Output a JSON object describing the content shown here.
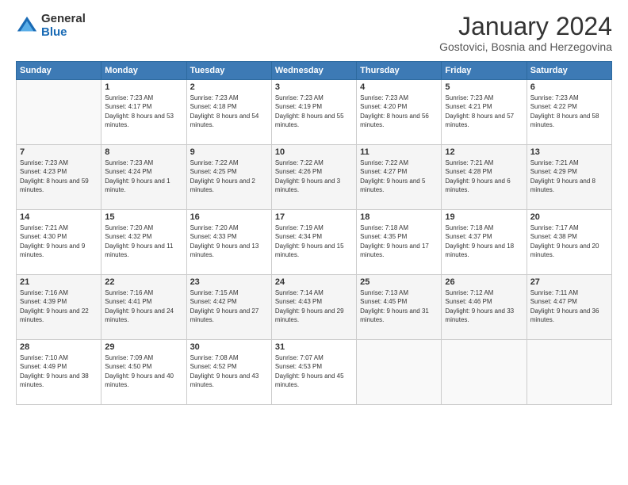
{
  "logo": {
    "general": "General",
    "blue": "Blue"
  },
  "title": "January 2024",
  "subtitle": "Gostovici, Bosnia and Herzegovina",
  "days_header": [
    "Sunday",
    "Monday",
    "Tuesday",
    "Wednesday",
    "Thursday",
    "Friday",
    "Saturday"
  ],
  "weeks": [
    [
      {
        "num": "",
        "sunrise": "",
        "sunset": "",
        "daylight": ""
      },
      {
        "num": "1",
        "sunrise": "Sunrise: 7:23 AM",
        "sunset": "Sunset: 4:17 PM",
        "daylight": "Daylight: 8 hours and 53 minutes."
      },
      {
        "num": "2",
        "sunrise": "Sunrise: 7:23 AM",
        "sunset": "Sunset: 4:18 PM",
        "daylight": "Daylight: 8 hours and 54 minutes."
      },
      {
        "num": "3",
        "sunrise": "Sunrise: 7:23 AM",
        "sunset": "Sunset: 4:19 PM",
        "daylight": "Daylight: 8 hours and 55 minutes."
      },
      {
        "num": "4",
        "sunrise": "Sunrise: 7:23 AM",
        "sunset": "Sunset: 4:20 PM",
        "daylight": "Daylight: 8 hours and 56 minutes."
      },
      {
        "num": "5",
        "sunrise": "Sunrise: 7:23 AM",
        "sunset": "Sunset: 4:21 PM",
        "daylight": "Daylight: 8 hours and 57 minutes."
      },
      {
        "num": "6",
        "sunrise": "Sunrise: 7:23 AM",
        "sunset": "Sunset: 4:22 PM",
        "daylight": "Daylight: 8 hours and 58 minutes."
      }
    ],
    [
      {
        "num": "7",
        "sunrise": "Sunrise: 7:23 AM",
        "sunset": "Sunset: 4:23 PM",
        "daylight": "Daylight: 8 hours and 59 minutes."
      },
      {
        "num": "8",
        "sunrise": "Sunrise: 7:23 AM",
        "sunset": "Sunset: 4:24 PM",
        "daylight": "Daylight: 9 hours and 1 minute."
      },
      {
        "num": "9",
        "sunrise": "Sunrise: 7:22 AM",
        "sunset": "Sunset: 4:25 PM",
        "daylight": "Daylight: 9 hours and 2 minutes."
      },
      {
        "num": "10",
        "sunrise": "Sunrise: 7:22 AM",
        "sunset": "Sunset: 4:26 PM",
        "daylight": "Daylight: 9 hours and 3 minutes."
      },
      {
        "num": "11",
        "sunrise": "Sunrise: 7:22 AM",
        "sunset": "Sunset: 4:27 PM",
        "daylight": "Daylight: 9 hours and 5 minutes."
      },
      {
        "num": "12",
        "sunrise": "Sunrise: 7:21 AM",
        "sunset": "Sunset: 4:28 PM",
        "daylight": "Daylight: 9 hours and 6 minutes."
      },
      {
        "num": "13",
        "sunrise": "Sunrise: 7:21 AM",
        "sunset": "Sunset: 4:29 PM",
        "daylight": "Daylight: 9 hours and 8 minutes."
      }
    ],
    [
      {
        "num": "14",
        "sunrise": "Sunrise: 7:21 AM",
        "sunset": "Sunset: 4:30 PM",
        "daylight": "Daylight: 9 hours and 9 minutes."
      },
      {
        "num": "15",
        "sunrise": "Sunrise: 7:20 AM",
        "sunset": "Sunset: 4:32 PM",
        "daylight": "Daylight: 9 hours and 11 minutes."
      },
      {
        "num": "16",
        "sunrise": "Sunrise: 7:20 AM",
        "sunset": "Sunset: 4:33 PM",
        "daylight": "Daylight: 9 hours and 13 minutes."
      },
      {
        "num": "17",
        "sunrise": "Sunrise: 7:19 AM",
        "sunset": "Sunset: 4:34 PM",
        "daylight": "Daylight: 9 hours and 15 minutes."
      },
      {
        "num": "18",
        "sunrise": "Sunrise: 7:18 AM",
        "sunset": "Sunset: 4:35 PM",
        "daylight": "Daylight: 9 hours and 17 minutes."
      },
      {
        "num": "19",
        "sunrise": "Sunrise: 7:18 AM",
        "sunset": "Sunset: 4:37 PM",
        "daylight": "Daylight: 9 hours and 18 minutes."
      },
      {
        "num": "20",
        "sunrise": "Sunrise: 7:17 AM",
        "sunset": "Sunset: 4:38 PM",
        "daylight": "Daylight: 9 hours and 20 minutes."
      }
    ],
    [
      {
        "num": "21",
        "sunrise": "Sunrise: 7:16 AM",
        "sunset": "Sunset: 4:39 PM",
        "daylight": "Daylight: 9 hours and 22 minutes."
      },
      {
        "num": "22",
        "sunrise": "Sunrise: 7:16 AM",
        "sunset": "Sunset: 4:41 PM",
        "daylight": "Daylight: 9 hours and 24 minutes."
      },
      {
        "num": "23",
        "sunrise": "Sunrise: 7:15 AM",
        "sunset": "Sunset: 4:42 PM",
        "daylight": "Daylight: 9 hours and 27 minutes."
      },
      {
        "num": "24",
        "sunrise": "Sunrise: 7:14 AM",
        "sunset": "Sunset: 4:43 PM",
        "daylight": "Daylight: 9 hours and 29 minutes."
      },
      {
        "num": "25",
        "sunrise": "Sunrise: 7:13 AM",
        "sunset": "Sunset: 4:45 PM",
        "daylight": "Daylight: 9 hours and 31 minutes."
      },
      {
        "num": "26",
        "sunrise": "Sunrise: 7:12 AM",
        "sunset": "Sunset: 4:46 PM",
        "daylight": "Daylight: 9 hours and 33 minutes."
      },
      {
        "num": "27",
        "sunrise": "Sunrise: 7:11 AM",
        "sunset": "Sunset: 4:47 PM",
        "daylight": "Daylight: 9 hours and 36 minutes."
      }
    ],
    [
      {
        "num": "28",
        "sunrise": "Sunrise: 7:10 AM",
        "sunset": "Sunset: 4:49 PM",
        "daylight": "Daylight: 9 hours and 38 minutes."
      },
      {
        "num": "29",
        "sunrise": "Sunrise: 7:09 AM",
        "sunset": "Sunset: 4:50 PM",
        "daylight": "Daylight: 9 hours and 40 minutes."
      },
      {
        "num": "30",
        "sunrise": "Sunrise: 7:08 AM",
        "sunset": "Sunset: 4:52 PM",
        "daylight": "Daylight: 9 hours and 43 minutes."
      },
      {
        "num": "31",
        "sunrise": "Sunrise: 7:07 AM",
        "sunset": "Sunset: 4:53 PM",
        "daylight": "Daylight: 9 hours and 45 minutes."
      },
      {
        "num": "",
        "sunrise": "",
        "sunset": "",
        "daylight": ""
      },
      {
        "num": "",
        "sunrise": "",
        "sunset": "",
        "daylight": ""
      },
      {
        "num": "",
        "sunrise": "",
        "sunset": "",
        "daylight": ""
      }
    ]
  ]
}
